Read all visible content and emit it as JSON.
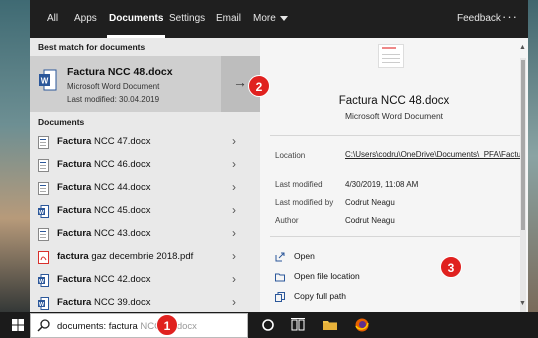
{
  "tabs": [
    {
      "label": "All",
      "active": false
    },
    {
      "label": "Apps",
      "active": false
    },
    {
      "label": "Documents",
      "active": true
    },
    {
      "label": "Settings",
      "active": false
    },
    {
      "label": "Email",
      "active": false
    },
    {
      "label": "More",
      "active": false
    }
  ],
  "feedback_label": "Feedback",
  "more_dots": "···",
  "best_match": {
    "header": "Best match for documents",
    "title": "Factura NCC 48.docx",
    "type": "Microsoft Word Document",
    "modified": "Last modified: 30.04.2019",
    "arrow": "→"
  },
  "documents_header": "Documents",
  "documents": [
    {
      "bold": "Factura",
      "rest": " NCC 47.docx",
      "icon": "word-doc-plain-icon"
    },
    {
      "bold": "Factura",
      "rest": " NCC 46.docx",
      "icon": "word-doc-plain-icon"
    },
    {
      "bold": "Factura",
      "rest": " NCC 44.docx",
      "icon": "word-doc-plain-icon"
    },
    {
      "bold": "Factura",
      "rest": " NCC 45.docx",
      "icon": "word-doc-icon"
    },
    {
      "bold": "Factura",
      "rest": " NCC 43.docx",
      "icon": "word-doc-plain-icon"
    },
    {
      "bold": "factura",
      "rest": " gaz decembrie 2018.pdf",
      "icon": "pdf-icon"
    },
    {
      "bold": "Factura",
      "rest": " NCC 42.docx",
      "icon": "word-doc-icon"
    },
    {
      "bold": "Factura",
      "rest": " NCC 39.docx",
      "icon": "word-doc-icon"
    }
  ],
  "chevron": "›",
  "details": {
    "title": "Factura NCC 48.docx",
    "type": "Microsoft Word Document",
    "location_label": "Location",
    "location_value": "C:\\Users\\codru\\OneDrive\\Documents\\_PFA\\Facturi",
    "modified_label": "Last modified",
    "modified_value": "4/30/2019, 11:08 AM",
    "modified_by_label": "Last modified by",
    "modified_by_value": "Codrut Neagu",
    "author_label": "Author",
    "author_value": "Codrut Neagu"
  },
  "actions": [
    {
      "label": "Open",
      "icon": "open-icon"
    },
    {
      "label": "Open file location",
      "icon": "folder-icon"
    },
    {
      "label": "Copy full path",
      "icon": "copy-icon"
    }
  ],
  "search": {
    "typed": "documents: factura",
    "ghost": " NCC 48.docx"
  },
  "callouts": [
    "1",
    "2",
    "3"
  ],
  "colors": {
    "callout": "#e0211f",
    "word_blue": "#2b579a",
    "pdf_red": "#d9302c"
  }
}
